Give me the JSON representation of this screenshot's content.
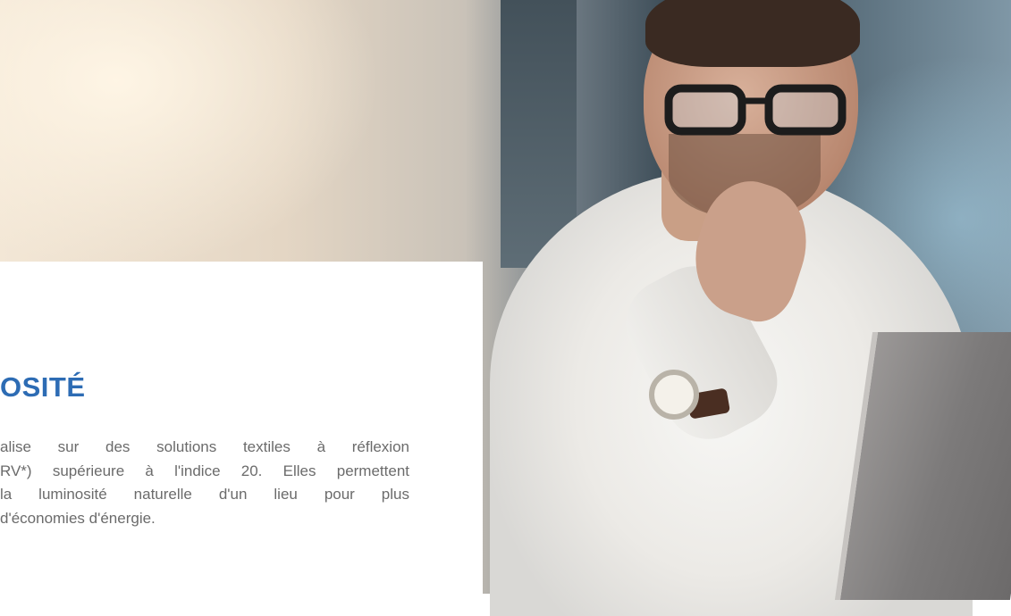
{
  "section": {
    "title": "OSITÉ",
    "paragraph_lines": [
      "alise sur des solutions textiles à réflexion",
      "RV*) supérieure à l'indice 20. Elles permettent",
      "la luminosité naturelle d'un lieu pour plus",
      "d'économies d'énergie."
    ]
  },
  "colors": {
    "title": "#2d6cb4",
    "body_text": "#6b6b6b",
    "card_background": "#ffffff"
  },
  "image": {
    "subject": "man-with-glasses-at-laptop-photo"
  }
}
